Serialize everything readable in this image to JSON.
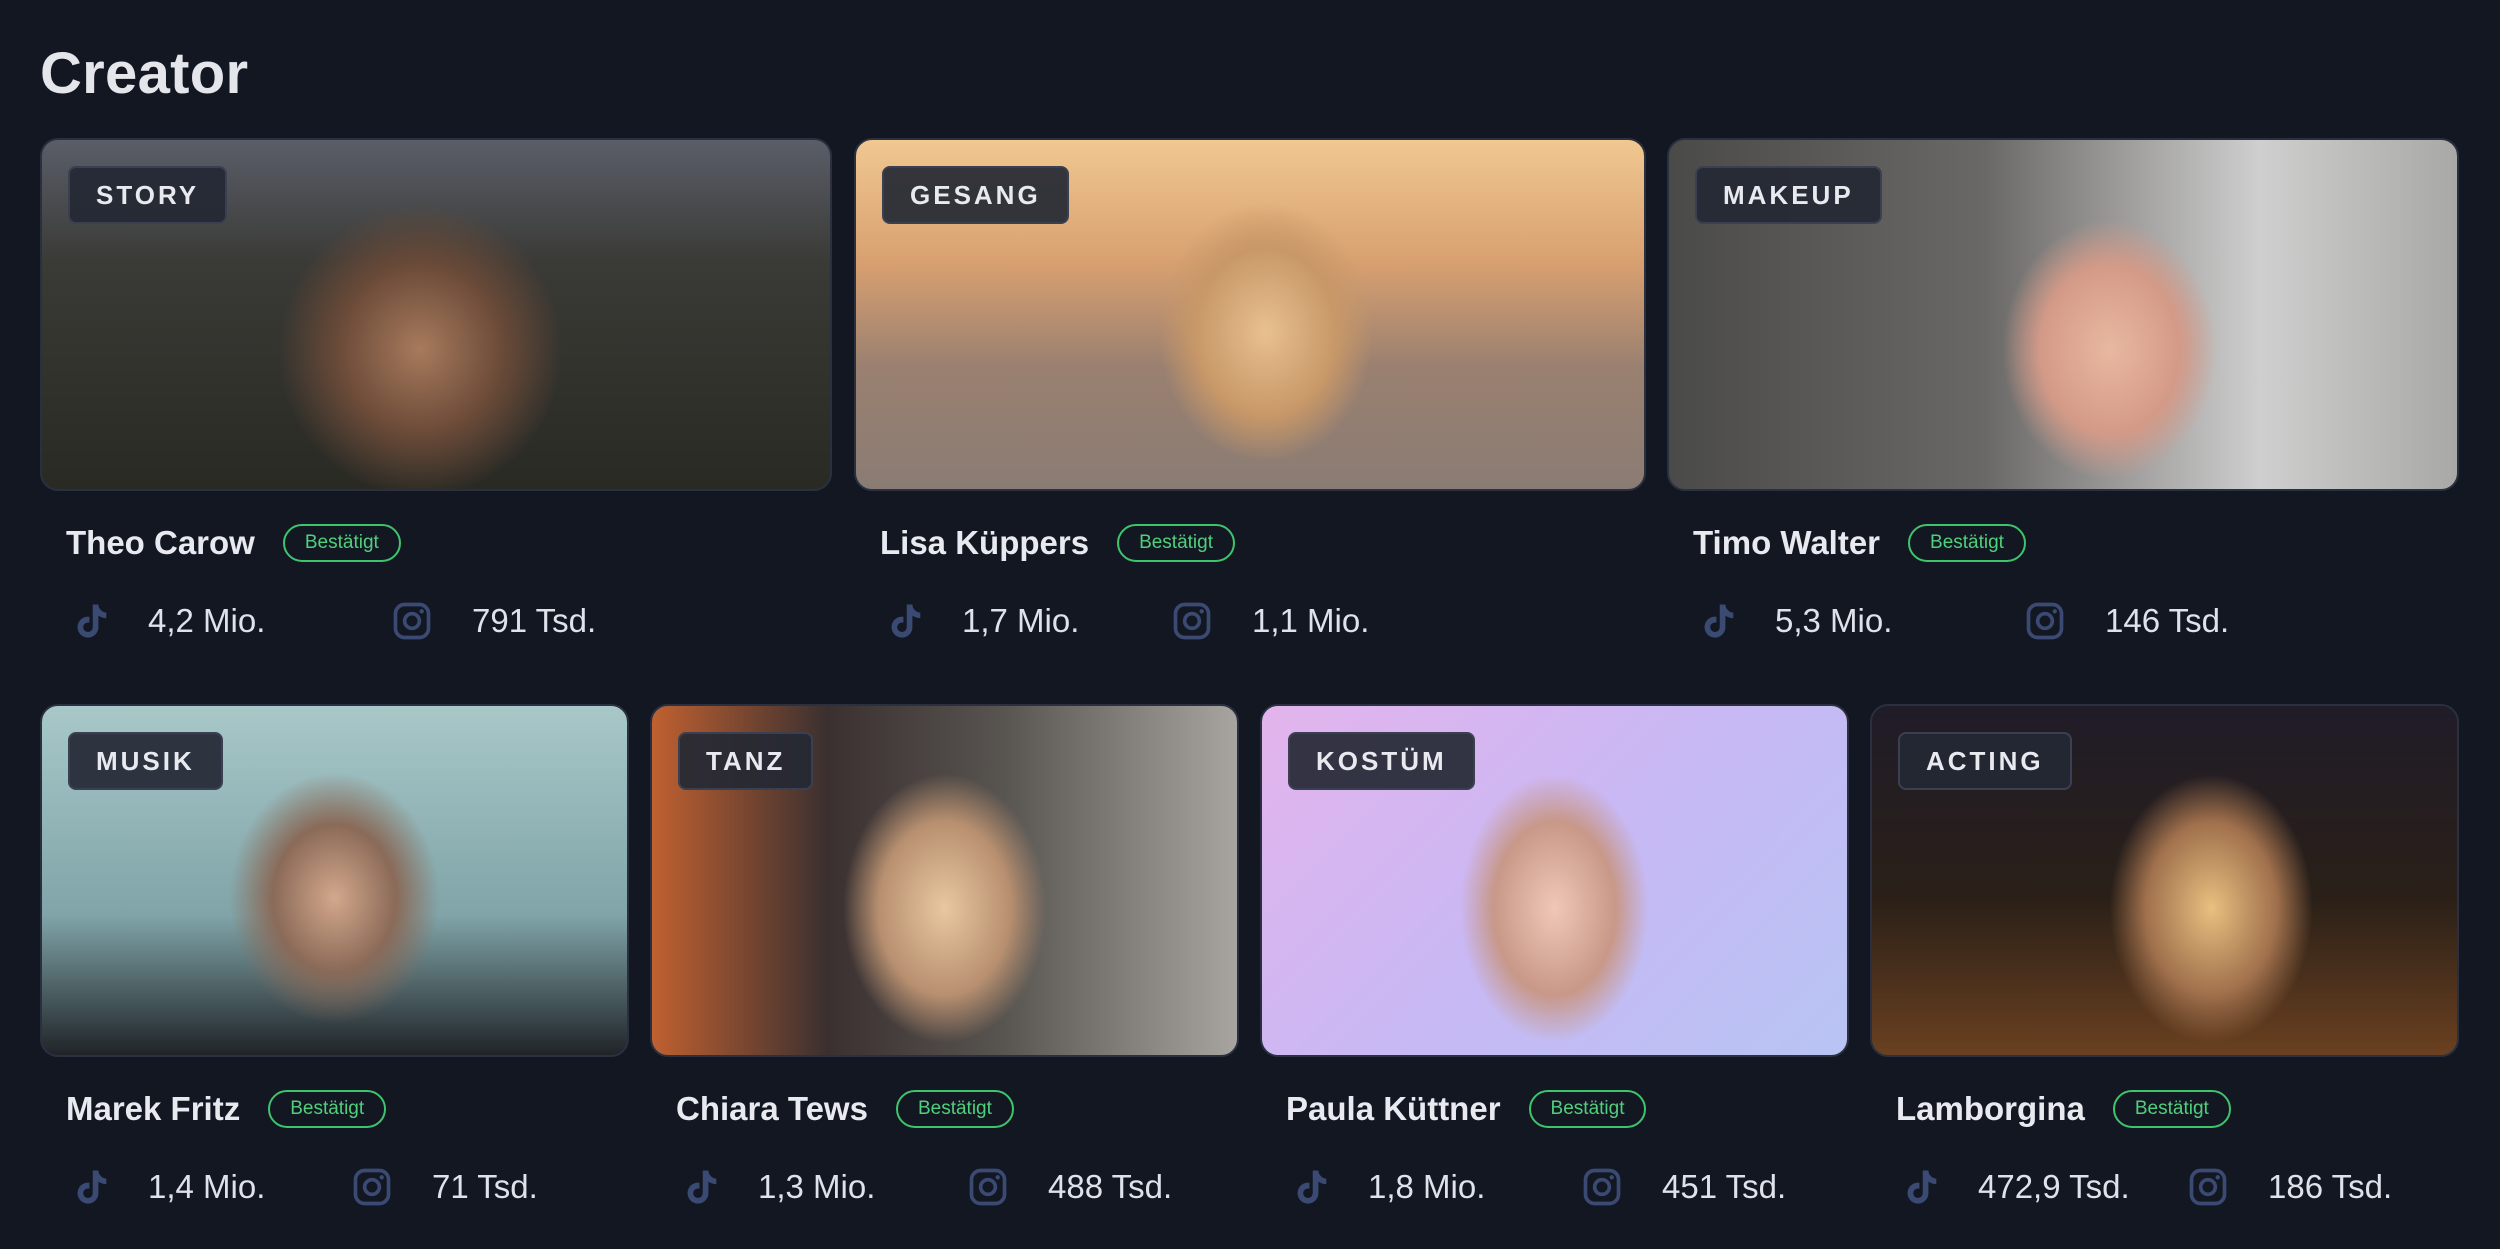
{
  "page": {
    "title": "Creator"
  },
  "colors": {
    "background": "#131722",
    "badge_green": "#3ec46d",
    "icon_blue": "#3a4a72"
  },
  "icons": {
    "tiktok": "tiktok-icon",
    "instagram": "instagram-icon"
  },
  "creators": [
    {
      "category": "STORY",
      "name": "Theo Carow",
      "badge": "Bestätigt",
      "tiktok": "4,2 Mio.",
      "instagram": "791 Tsd."
    },
    {
      "category": "GESANG",
      "name": "Lisa Küppers",
      "badge": "Bestätigt",
      "tiktok": "1,7 Mio.",
      "instagram": "1,1 Mio."
    },
    {
      "category": "MAKEUP",
      "name": "Timo Walter",
      "badge": "Bestätigt",
      "tiktok": "5,3 Mio.",
      "instagram": "146 Tsd."
    },
    {
      "category": "MUSIK",
      "name": "Marek Fritz",
      "badge": "Bestätigt",
      "tiktok": "1,4 Mio.",
      "instagram": "71 Tsd."
    },
    {
      "category": "TANZ",
      "name": "Chiara Tews",
      "badge": "Bestätigt",
      "tiktok": "1,3 Mio.",
      "instagram": "488 Tsd."
    },
    {
      "category": "KOSTÜM",
      "name": "Paula Küttner",
      "badge": "Bestätigt",
      "tiktok": "1,8 Mio.",
      "instagram": "451 Tsd."
    },
    {
      "category": "ACTING",
      "name": "Lamborgina",
      "badge": "Bestätigt",
      "tiktok": "472,9 Tsd.",
      "instagram": "186 Tsd."
    }
  ]
}
